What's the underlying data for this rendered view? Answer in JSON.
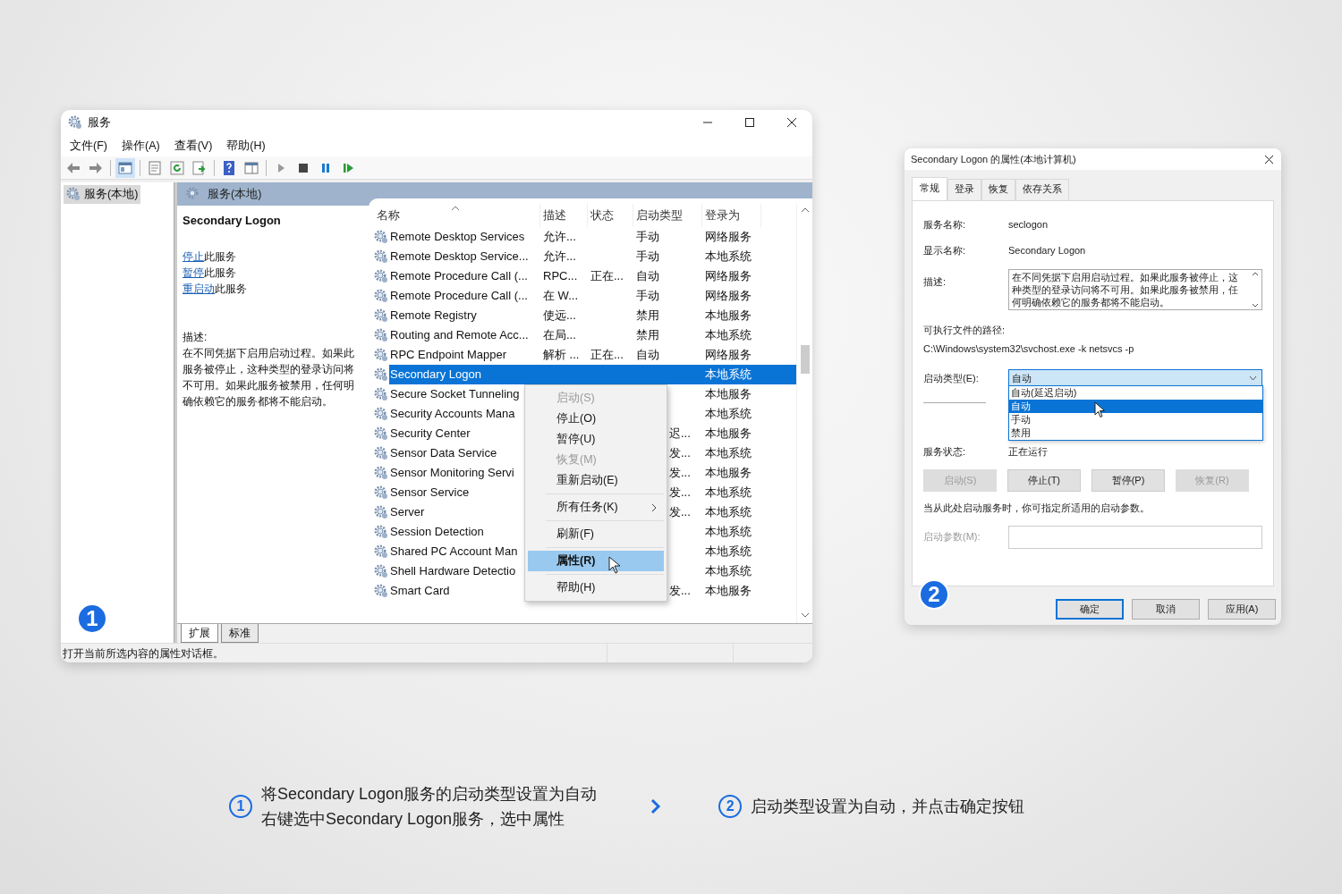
{
  "services_window": {
    "title": "服务",
    "menu": [
      "文件(F)",
      "操作(A)",
      "查看(V)",
      "帮助(H)"
    ],
    "tree": [
      {
        "label": "服务(本地)",
        "selected": true
      }
    ],
    "header": "服务(本地)",
    "detail": {
      "name": "Secondary Logon",
      "actions": [
        {
          "link": "停止",
          "text": "此服务"
        },
        {
          "link": "暂停",
          "text": "此服务"
        },
        {
          "link": "重启动",
          "text": "此服务"
        }
      ],
      "description_label": "描述:",
      "description": "在不同凭据下启用启动过程。如果此服务被停止，这种类型的登录访问将不可用。如果此服务被禁用，任何明确依赖它的服务都将不能启动。"
    },
    "columns": [
      "名称",
      "描述",
      "状态",
      "启动类型",
      "登录为"
    ],
    "rows": [
      {
        "name": "Remote Desktop Services",
        "description": "允许...",
        "startup_type": "手动",
        "log_on_as": "网络服务",
        "selected": false
      },
      {
        "name": "Remote Desktop Service...",
        "description": "允许...",
        "startup_type": "手动",
        "log_on_as": "本地系统",
        "selected": false
      },
      {
        "name": "Remote Procedure Call (...",
        "description": "RPC...",
        "status": "正在...",
        "startup_type": "自动",
        "log_on_as": "网络服务",
        "selected": false
      },
      {
        "name": "Remote Procedure Call (...",
        "description": "在 W...",
        "startup_type": "手动",
        "log_on_as": "网络服务",
        "selected": false
      },
      {
        "name": "Remote Registry",
        "description": "使远...",
        "startup_type": "禁用",
        "log_on_as": "本地服务",
        "selected": false
      },
      {
        "name": "Routing and Remote Acc...",
        "description": "在局...",
        "startup_type": "禁用",
        "log_on_as": "本地系统",
        "selected": false
      },
      {
        "name": "RPC Endpoint Mapper",
        "description": "解析 ...",
        "status": "正在...",
        "startup_type": "自动",
        "log_on_as": "网络服务",
        "selected": false
      },
      {
        "name": "Secondary Logon",
        "log_on_as": "本地系统",
        "selected": true
      },
      {
        "name": "Secure Socket Tunneling",
        "log_on_as": "本地服务",
        "selected": false
      },
      {
        "name": "Security Accounts Mana",
        "log_on_as": "本地系统",
        "selected": false
      },
      {
        "name": "Security Center",
        "startup_type": "迟...",
        "log_on_as": "本地服务",
        "selected": false
      },
      {
        "name": "Sensor Data Service",
        "startup_type": "发...",
        "log_on_as": "本地系统",
        "selected": false
      },
      {
        "name": "Sensor Monitoring Servi",
        "startup_type": "发...",
        "log_on_as": "本地服务",
        "selected": false
      },
      {
        "name": "Sensor Service",
        "startup_type": "发...",
        "log_on_as": "本地系统",
        "selected": false
      },
      {
        "name": "Server",
        "startup_type": "发...",
        "log_on_as": "本地系统",
        "selected": false
      },
      {
        "name": "Session Detection",
        "log_on_as": "本地系统",
        "selected": false
      },
      {
        "name": "Shared PC Account Man",
        "log_on_as": "本地系统",
        "selected": false
      },
      {
        "name": "Shell Hardware Detectio",
        "log_on_as": "本地系统",
        "selected": false
      },
      {
        "name": "Smart Card",
        "startup_type": "发...",
        "log_on_as": "本地服务",
        "selected": false
      }
    ],
    "context_menu": [
      {
        "kind": "item",
        "label": "启动(S)",
        "disabled": true,
        "selected": false
      },
      {
        "kind": "item",
        "label": "停止(O)",
        "disabled": false,
        "selected": false
      },
      {
        "kind": "item",
        "label": "暂停(U)",
        "disabled": false,
        "selected": false
      },
      {
        "kind": "item",
        "label": "恢复(M)",
        "disabled": true,
        "selected": false
      },
      {
        "kind": "item",
        "label": "重新启动(E)",
        "disabled": false,
        "selected": false
      },
      {
        "kind": "separator"
      },
      {
        "kind": "item",
        "label": "所有任务(K)",
        "disabled": false,
        "selected": false,
        "submenu": true
      },
      {
        "kind": "separator"
      },
      {
        "kind": "item",
        "label": "刷新(F)",
        "disabled": false,
        "selected": false
      },
      {
        "kind": "separator"
      },
      {
        "kind": "item",
        "label": "属性(R)",
        "disabled": false,
        "selected": true
      },
      {
        "kind": "separator"
      },
      {
        "kind": "item",
        "label": "帮助(H)",
        "disabled": false,
        "selected": false
      }
    ],
    "view_tabs": [
      {
        "label": "扩展",
        "selected": true
      },
      {
        "label": "标准",
        "selected": false
      }
    ],
    "status_bar": "打开当前所选内容的属性对话框。",
    "step_badge": "1"
  },
  "properties_dialog": {
    "title": "Secondary Logon 的属性(本地计算机)",
    "tabs": [
      {
        "label": "常规",
        "selected": true
      },
      {
        "label": "登录",
        "selected": false
      },
      {
        "label": "恢复",
        "selected": false
      },
      {
        "label": "依存关系",
        "selected": false
      }
    ],
    "service_name": {
      "label": "服务名称:",
      "value": "seclogon"
    },
    "display_name": {
      "label": "显示名称:",
      "value": "Secondary Logon"
    },
    "description": {
      "label": "描述:",
      "value": "在不同凭据下启用启动过程。如果此服务被停止，这种类型的登录访问将不可用。如果此服务被禁用，任何明确依赖它的服务都将不能启动。"
    },
    "path": {
      "label": "可执行文件的路径:",
      "value": "C:\\Windows\\system32\\svchost.exe -k netsvcs -p"
    },
    "startup_type": {
      "label": "启动类型(E):",
      "value": "自动",
      "options": [
        {
          "label": "自动(延迟启动)",
          "selected": false
        },
        {
          "label": "自动",
          "selected": true
        },
        {
          "label": "手动",
          "selected": false
        },
        {
          "label": "禁用",
          "selected": false
        }
      ]
    },
    "service_status": {
      "label": "服务状态:",
      "value": "正在运行"
    },
    "control_buttons": [
      {
        "label": "启动(S)",
        "disabled": true
      },
      {
        "label": "停止(T)",
        "disabled": false
      },
      {
        "label": "暂停(P)",
        "disabled": false
      },
      {
        "label": "恢复(R)",
        "disabled": true
      }
    ],
    "hint": "当从此处启动服务时，你可指定所适用的启动参数。",
    "start_parameters": {
      "label": "启动参数(M):",
      "disabled": true
    },
    "footer_buttons": [
      {
        "label": "确定",
        "default": true
      },
      {
        "label": "取消",
        "default": false
      },
      {
        "label": "应用(A)",
        "default": false
      }
    ],
    "step_badge": "2"
  },
  "caption": {
    "steps": [
      {
        "number": "1",
        "lines": [
          "将Secondary Logon服务的启动类型设置为自动",
          "右键选中Secondary Logon服务，选中属性"
        ]
      },
      {
        "number": "2",
        "lines": [
          "启动类型设置为自动，并点击确定按钮"
        ]
      }
    ]
  }
}
